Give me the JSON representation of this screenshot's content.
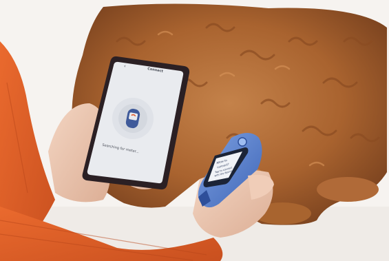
{
  "phone": {
    "header_title": "Connect",
    "status_text": "Searching for meter..."
  },
  "meter": {
    "screen_line_1": "Allow to",
    "screen_line_2": "connect?",
    "screen_line_3": "Tap to connect",
    "screen_line_4": "with the device"
  },
  "icons": {
    "phone_back": "chevron-left-icon",
    "phone_meter": "glucose-meter-icon",
    "phone_bluetooth": "bluetooth-signal-icon"
  },
  "colors": {
    "sweater": "#e0612a",
    "dog_fur": "#b06a38",
    "meter_body": "#5b84d0",
    "phone_screen": "#e9ebef"
  }
}
